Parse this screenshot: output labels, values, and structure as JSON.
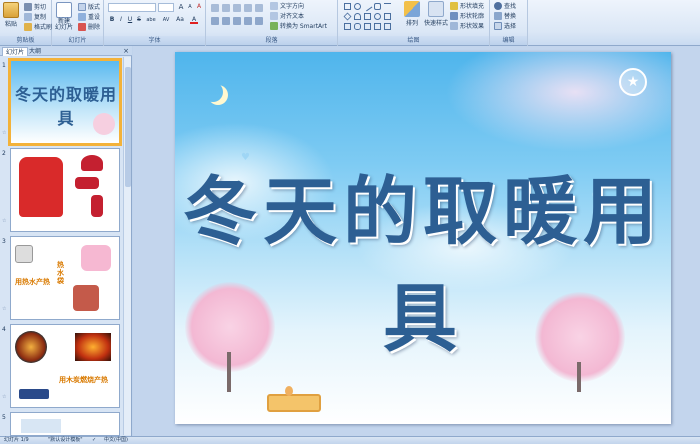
{
  "ribbon": {
    "clipboard": {
      "paste": "粘贴",
      "cut": "剪切",
      "copy": "复制",
      "format_painter": "格式刷",
      "label": "剪贴板"
    },
    "slides": {
      "new_slide": "新建\n幻灯片",
      "layout": "版式",
      "reset": "重设",
      "delete": "删除",
      "label": "幻灯片"
    },
    "font": {
      "font_name": "",
      "font_size": "",
      "grow": "A",
      "shrink": "A",
      "clear": "A",
      "bold": "B",
      "italic": "I",
      "underline": "U",
      "strike": "S",
      "shadow": "abe",
      "spacing": "AV",
      "case": "Aa",
      "color": "A",
      "label": "字体"
    },
    "paragraph": {
      "text_direction": "文字方向",
      "align_text": "对齐文本",
      "smartart": "转换为 SmartArt",
      "label": "段落"
    },
    "drawing": {
      "arrange": "排列",
      "quick_styles": "快速样式",
      "shape_fill": "形状填充",
      "shape_outline": "形状轮廓",
      "shape_effects": "形状效果",
      "label": "绘图"
    },
    "editing": {
      "find": "查找",
      "replace": "替换",
      "select": "选择",
      "label": "编辑"
    }
  },
  "panel": {
    "tab_slides": "幻灯片",
    "tab_outline": "大纲",
    "close": "×",
    "thumbnails": [
      {
        "num": "1",
        "title": "冬天的取暖用具"
      },
      {
        "num": "2"
      },
      {
        "num": "3",
        "caption1": "热水袋",
        "caption2": "用热水产热"
      },
      {
        "num": "4",
        "caption1": "用木炭燃烧产热"
      },
      {
        "num": "5"
      }
    ]
  },
  "slide": {
    "title": "冬天的取暖用具"
  },
  "status": {
    "slide_count": "幻灯片 1/9",
    "theme": "\"默认设计模板\"",
    "language": "中文(中国)"
  },
  "colors": {
    "title": "#2d5f93",
    "sky_top": "#4fb5ec",
    "ribbon_bg": "#dbe7f6",
    "selection": "#f3b23a"
  }
}
